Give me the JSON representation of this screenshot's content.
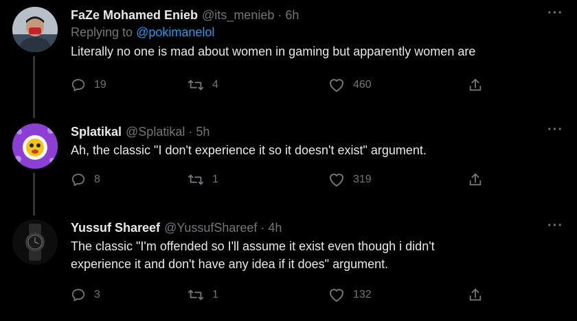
{
  "tweets": [
    {
      "name": "FaZe Mohamed Enieb",
      "handle": "@its_menieb",
      "separator": "·",
      "time": "6h",
      "replying_prefix": "Replying to",
      "replying_to": "@pokimanelol",
      "text": "Literally no one is mad about women in gaming but apparently women are",
      "replies": "19",
      "retweets": "4",
      "likes": "460",
      "more": "···"
    },
    {
      "name": "Splatikal",
      "handle": "@Splatikal",
      "separator": "·",
      "time": "5h",
      "text": "Ah, the classic \"I don't experience it so it doesn't exist\" argument.",
      "replies": "8",
      "retweets": "1",
      "likes": "319",
      "more": "···"
    },
    {
      "name": "Yussuf Shareef",
      "handle": "@YussufShareef",
      "separator": "·",
      "time": "4h",
      "text_line1": "The classic \"I'm offended so I'll assume it exist even though i didn't",
      "text_line2": "experience it and don't have any idea if it does\" argument.",
      "replies": "3",
      "retweets": "1",
      "likes": "132",
      "more": "···"
    }
  ],
  "colors": {
    "background": "#000000",
    "text": "#e7e9ea",
    "secondary": "#71767b",
    "accent": "#1d9bf0",
    "thread_line": "#333639"
  },
  "icons": [
    "reply-icon",
    "retweet-icon",
    "like-icon",
    "share-icon"
  ]
}
